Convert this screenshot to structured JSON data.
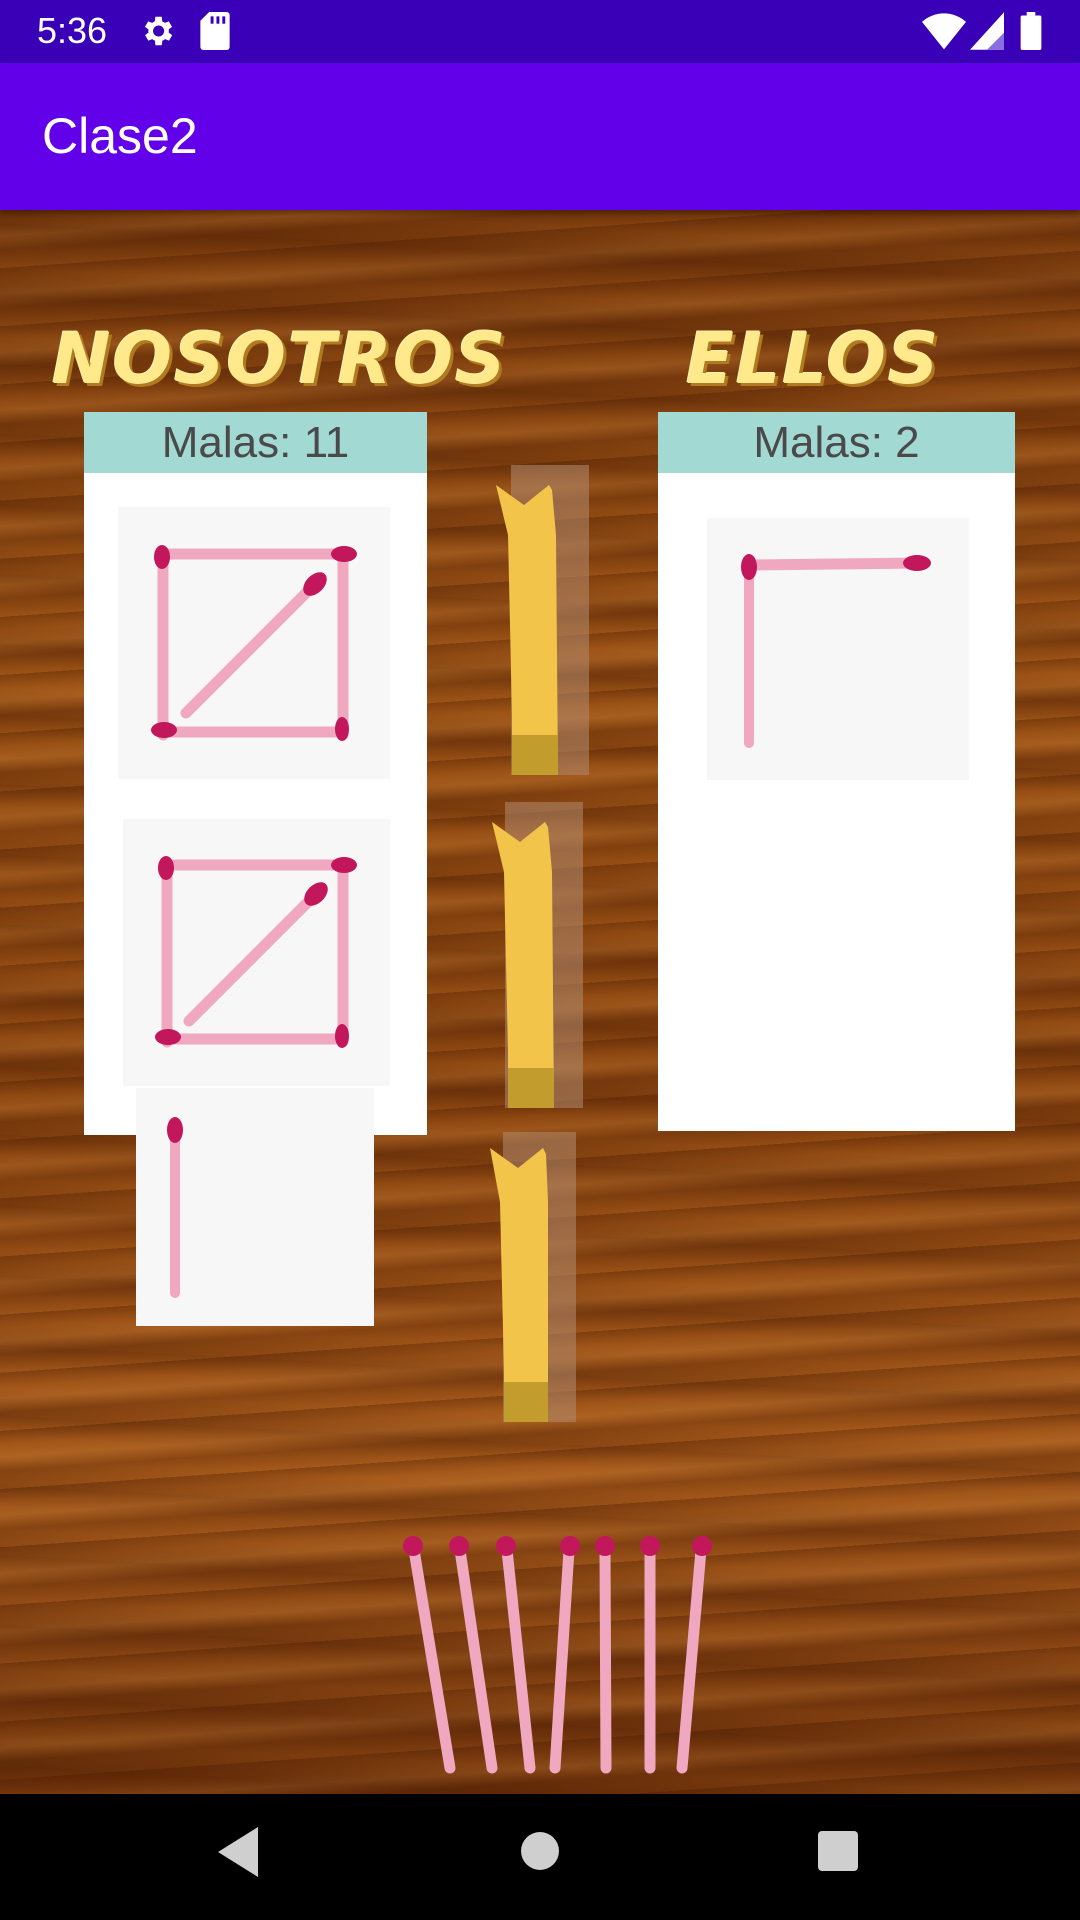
{
  "status_bar": {
    "time": "5:36"
  },
  "app_bar": {
    "title": "Clase2"
  },
  "scoreboard": {
    "us": {
      "title": "NOSOTROS",
      "score_label": "Malas: 11"
    },
    "them": {
      "title": "ELLOS",
      "score_label": "Malas: 2"
    }
  },
  "icons": {
    "status": [
      "gear-icon",
      "sd-card-icon",
      "wifi-icon",
      "signal-icon",
      "battery-icon"
    ],
    "nav": [
      "back-icon",
      "home-icon",
      "recents-icon"
    ]
  },
  "colors": {
    "status_bar": "#3a00b8",
    "app_bar": "#6200ea",
    "score_header": "#a2d9d2",
    "team_title": "#ffe98a",
    "match_stick": "#f0a8c0",
    "match_head": "#c2185b",
    "tape": "#f2c54a"
  }
}
